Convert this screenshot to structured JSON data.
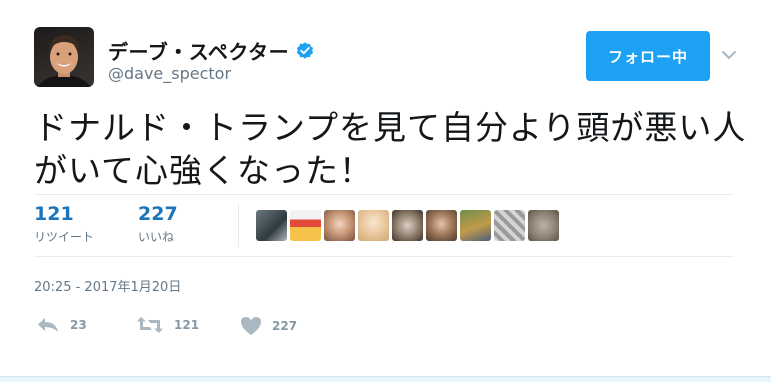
{
  "tweet": {
    "display_name": "デーブ・スペクター",
    "screen_name": "@dave_spector",
    "follow_label": "フォロー中",
    "text": "ドナルド・トランプを見て自分より頭が悪い人\nがいて心強くなった！",
    "retweet_count": "121",
    "retweet_label": "リツイート",
    "like_count": "227",
    "like_label": "いいね",
    "timestamp": "20:25 - 2017年1月20日",
    "actions": {
      "reply_count": "23",
      "retweet_count": "121",
      "like_count": "227"
    }
  },
  "colors": {
    "accent": "#1da1f2",
    "stat_count": "#1b75bb",
    "muted": "#657786",
    "verified": "#1da1f2"
  },
  "icons": [
    "verified-badge-icon",
    "caret-down-icon",
    "reply-icon",
    "retweet-icon",
    "heart-icon"
  ]
}
